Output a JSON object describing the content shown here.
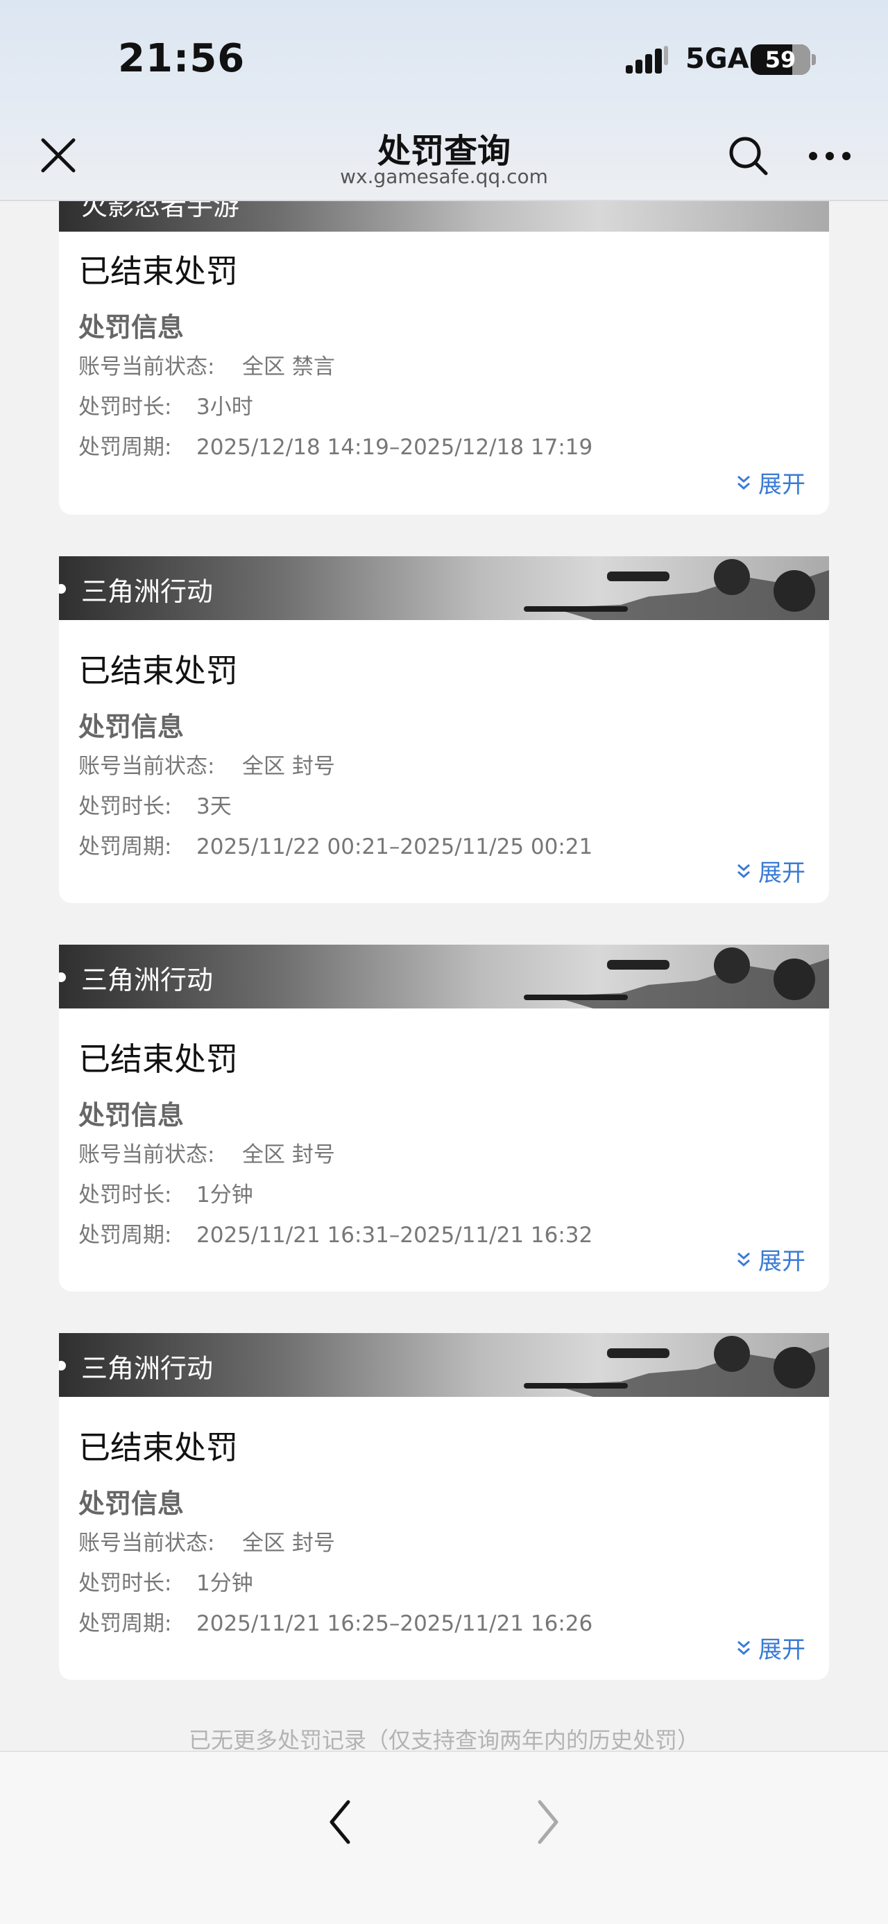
{
  "status_bar": {
    "time": "21:56",
    "network": "5GA",
    "battery": "59"
  },
  "nav": {
    "title": "处罚查询",
    "url": "wx.gamesafe.qq.com"
  },
  "labels": {
    "section": "处罚信息",
    "status_key": "账号当前状态:",
    "duration_key": "处罚时长:",
    "period_key": "处罚周期:",
    "expand": "展开"
  },
  "records": [
    {
      "game": "火影忍者手游",
      "status": "已结束处罚",
      "account_status": "全区 禁言",
      "duration": "3小时",
      "period": "2025/12/18 14:19–2025/12/18 17:19"
    },
    {
      "game": "三角洲行动",
      "status": "已结束处罚",
      "account_status": "全区 封号",
      "duration": "3天",
      "period": "2025/11/22 00:21–2025/11/25 00:21"
    },
    {
      "game": "三角洲行动",
      "status": "已结束处罚",
      "account_status": "全区 封号",
      "duration": "1分钟",
      "period": "2025/11/21 16:31–2025/11/21 16:32"
    },
    {
      "game": "三角洲行动",
      "status": "已结束处罚",
      "account_status": "全区 封号",
      "duration": "1分钟",
      "period": "2025/11/21 16:25–2025/11/21 16:26"
    }
  ],
  "footer": "已无更多处罚记录（仅支持查询两年内的历史处罚）"
}
